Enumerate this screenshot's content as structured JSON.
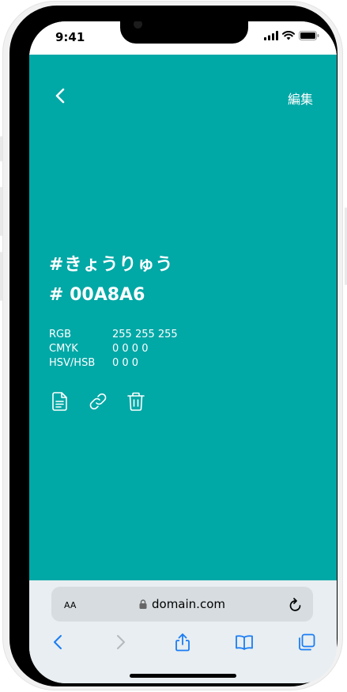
{
  "status_bar": {
    "time": "9:41"
  },
  "app": {
    "background": "#00a8a6",
    "header": {
      "edit_label": "編集"
    },
    "color": {
      "name": "#きょうりゅう",
      "hex": "# 00A8A6",
      "specs": [
        {
          "label": "RGB",
          "value": "255 255 255"
        },
        {
          "label": "CMYK",
          "value": "0 0 0 0"
        },
        {
          "label": "HSV/HSB",
          "value": "0 0 0"
        }
      ]
    },
    "actions": [
      "document-icon",
      "link-icon",
      "trash-icon"
    ]
  },
  "browser": {
    "text_size_label": "AA",
    "url": "domain.com",
    "accent": "#1a7cf5"
  }
}
